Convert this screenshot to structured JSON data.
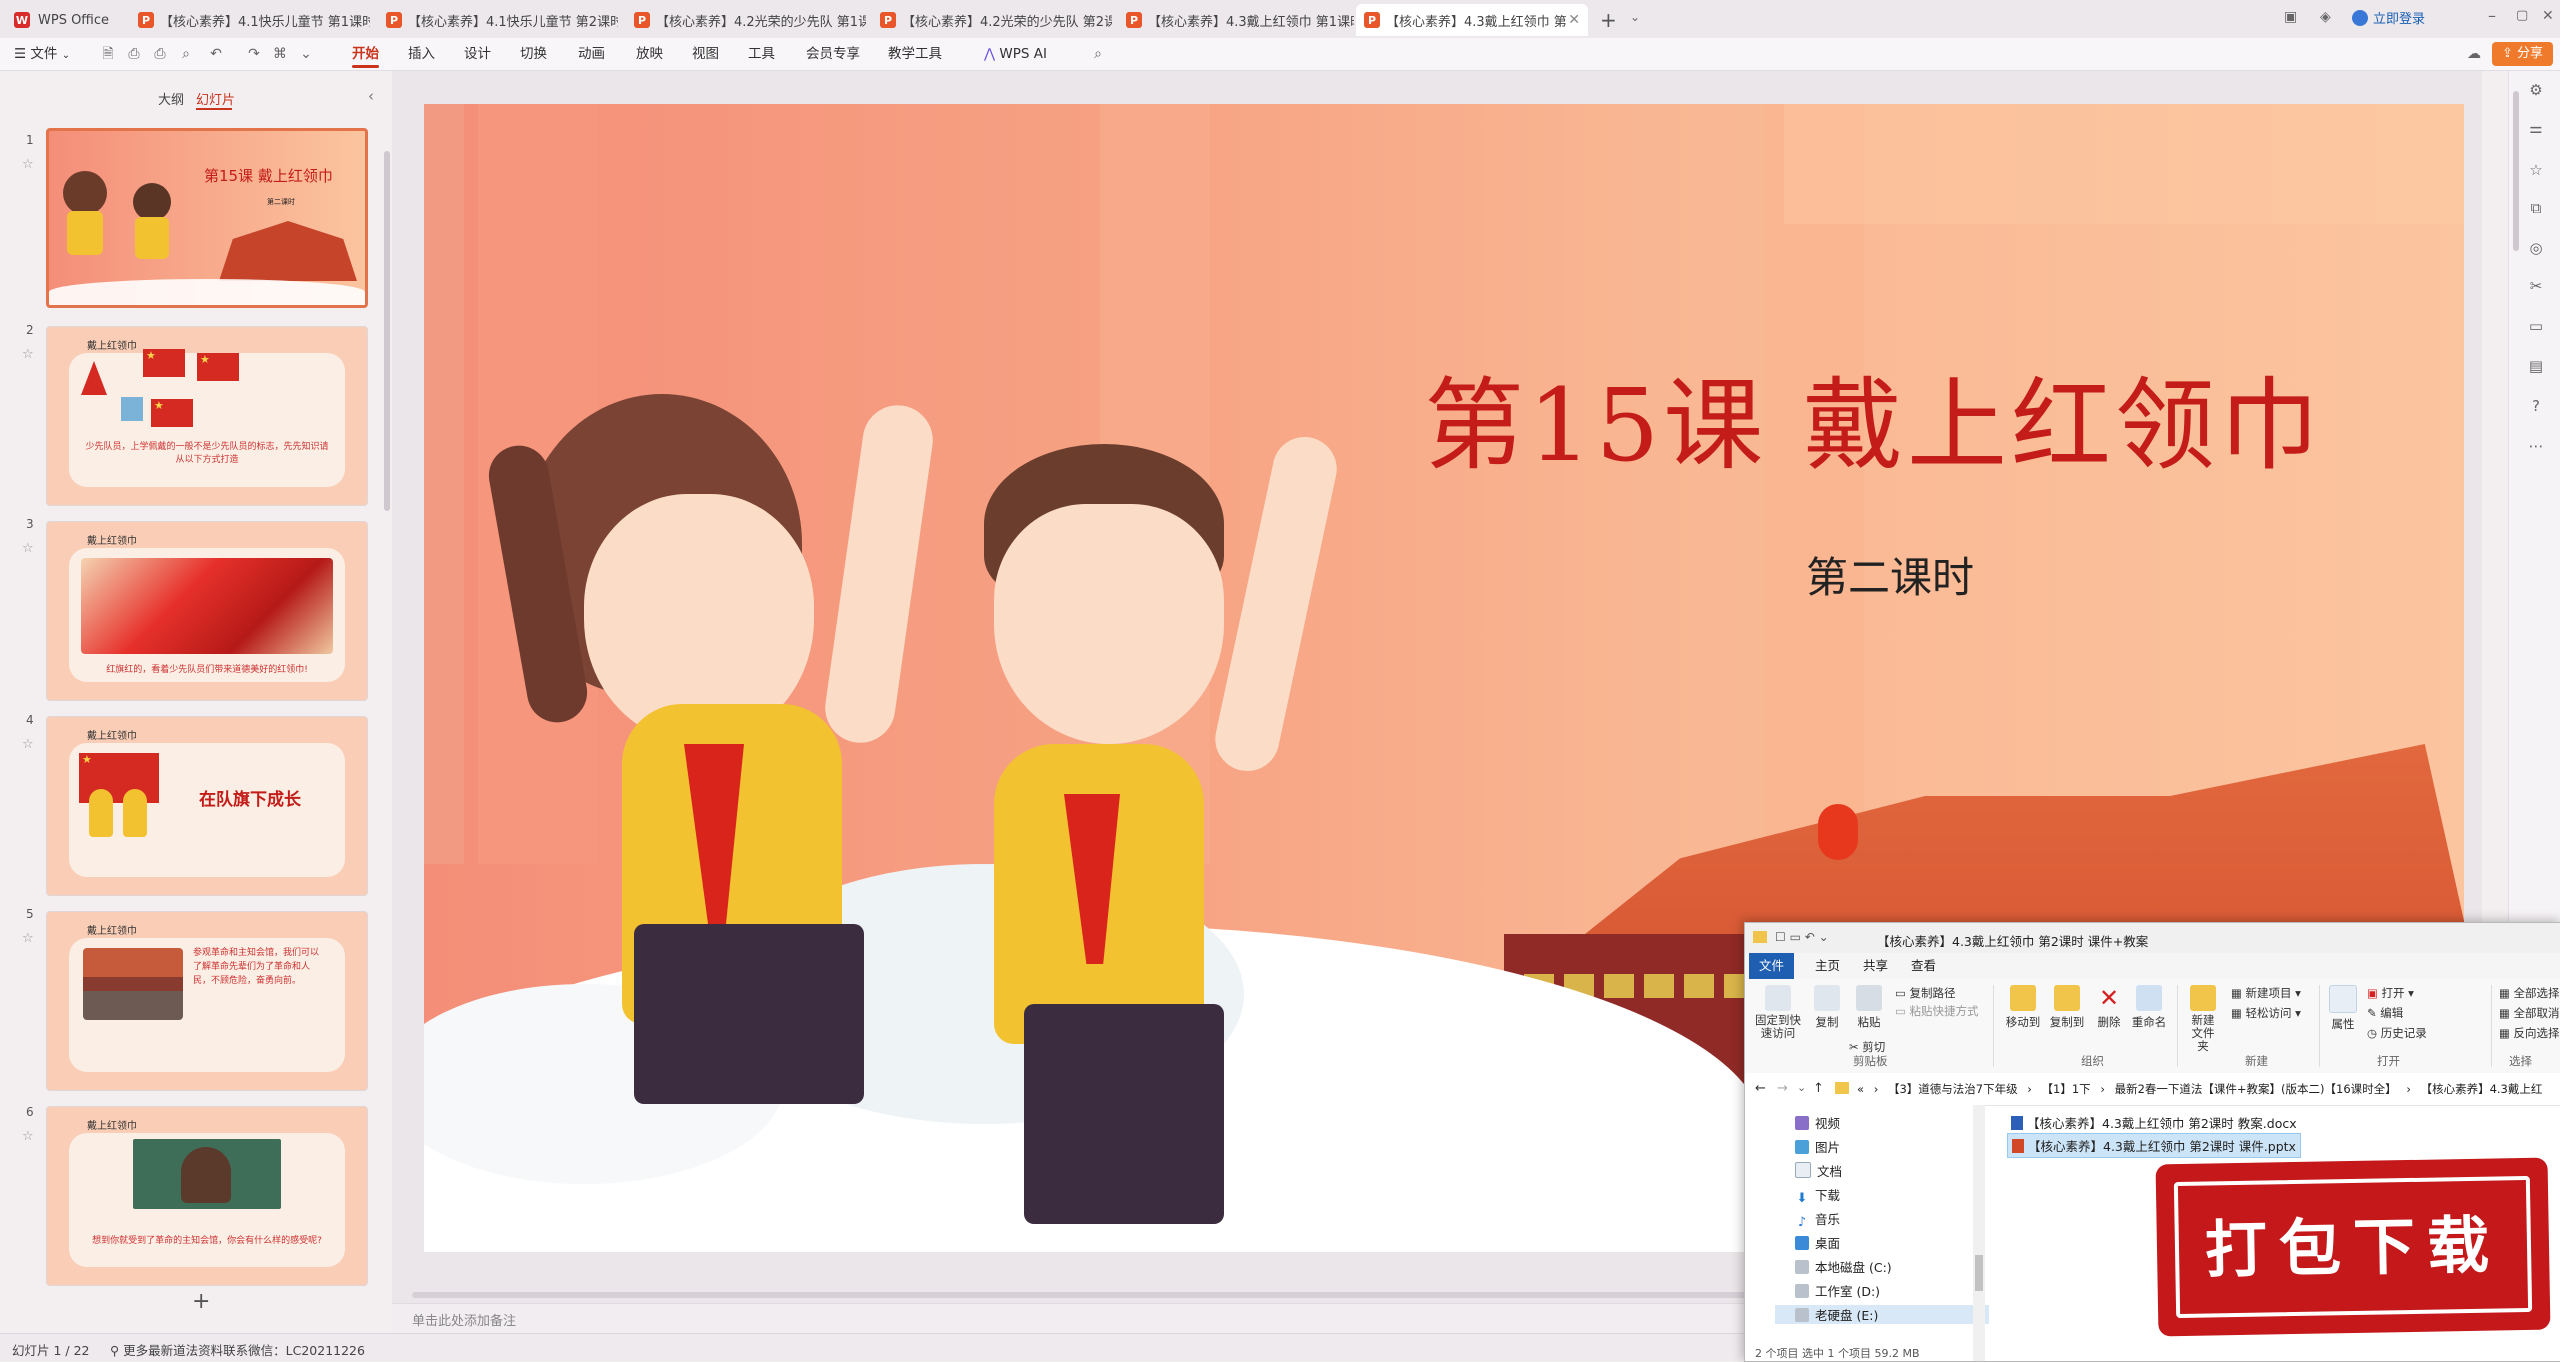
{
  "tabs": [
    {
      "label": "WPS Office",
      "kind": "home"
    },
    {
      "label": "【核心素养】4.1快乐儿童节 第1课时"
    },
    {
      "label": "【核心素养】4.1快乐儿童节 第2课时"
    },
    {
      "label": "【核心素养】4.2光荣的少先队 第1课"
    },
    {
      "label": "【核心素养】4.2光荣的少先队 第2课"
    },
    {
      "label": "【核心素养】4.3戴上红领巾 第1课时"
    },
    {
      "label": "【核心素养】4.3戴上红领巾 第"
    }
  ],
  "login_label": "立即登录",
  "share_label": "分享",
  "menu": {
    "file": "文件",
    "items": [
      "开始",
      "插入",
      "设计",
      "切换",
      "动画",
      "放映",
      "视图",
      "工具",
      "会员专享",
      "教学工具"
    ],
    "wps_ai": "WPS AI"
  },
  "left_panel": {
    "tabs": [
      "大纲",
      "幻灯片"
    ],
    "add_label": "+",
    "thumbs": [
      {
        "num": "1",
        "title": "第15课  戴上红领巾",
        "sub": "第二课时"
      },
      {
        "num": "2",
        "label": "戴上红领巾",
        "caption": "少先队员，上学佩戴的一般不是少先队员的标志，先先知识请从以下方式打造"
      },
      {
        "num": "3",
        "label": "戴上红领巾",
        "caption": "红旗红的，看着少先队员们带来道德美好的红领巾!"
      },
      {
        "num": "4",
        "label": "戴上红领巾",
        "heading": "在队旗下成长"
      },
      {
        "num": "5",
        "label": "戴上红领巾",
        "caption": "参观革命和主知会馆，我们可以了解革命先辈们为了革命和人民，不顾危险，奋勇向前。"
      },
      {
        "num": "6",
        "label": "戴上红领巾",
        "caption": "想到你就受到了革命的主知会馆，你会有什么样的感受呢?"
      }
    ]
  },
  "slide": {
    "title": "第15课  戴上红领巾",
    "subtitle": "第二课时"
  },
  "notes_placeholder": "单击此处添加备注",
  "status": {
    "slide_counter": "幻灯片 1 / 22",
    "info": "更多最新道法资料联系微信：LC20211226"
  },
  "explorer": {
    "title": "【核心素养】4.3戴上红领巾 第2课时 课件+教案",
    "tabs": [
      "文件",
      "主页",
      "共享",
      "查看"
    ],
    "ribbon": {
      "pin": "固定到快速访问",
      "copy": "复制",
      "paste": "粘贴",
      "copy_path": "复制路径",
      "paste_shortcut": "粘贴快捷方式",
      "cut": "剪切",
      "clipboard": "剪贴板",
      "move_to": "移动到",
      "copy_to": "复制到",
      "delete": "删除",
      "rename": "重命名",
      "organize": "组织",
      "new_folder": "新建文件夹",
      "new_item": "新建项目",
      "easy_access": "轻松访问",
      "new": "新建",
      "properties": "属性",
      "open": "打开",
      "edit": "编辑",
      "history": "历史记录",
      "open_group": "打开",
      "select_all": "全部选择",
      "select_none": "全部取消",
      "invert": "反向选择",
      "select_group": "选择"
    },
    "breadcrumb": [
      "«",
      "【3】道德与法治7下年级",
      "【1】1下",
      "最新2春一下道法【课件+教案】(版本二)【16课时全】",
      "【核心素养】4.3戴上红"
    ],
    "nav": [
      "视频",
      "图片",
      "文档",
      "下载",
      "音乐",
      "桌面",
      "本地磁盘 (C:)",
      "工作室 (D:)",
      "老硬盘 (E:)"
    ],
    "files": [
      {
        "name": "【核心素养】4.3戴上红领巾 第2课时 教案.docx",
        "type": "docx"
      },
      {
        "name": "【核心素养】4.3戴上红领巾 第2课时 课件.pptx",
        "type": "pptx"
      }
    ],
    "status": "2 个项目   选中 1 个项目  59.2 MB"
  },
  "stamp_text": "打包下载",
  "colors": {
    "accent": "#c9341c",
    "title_red": "#c41c18",
    "stamp_red": "#c4181a"
  }
}
